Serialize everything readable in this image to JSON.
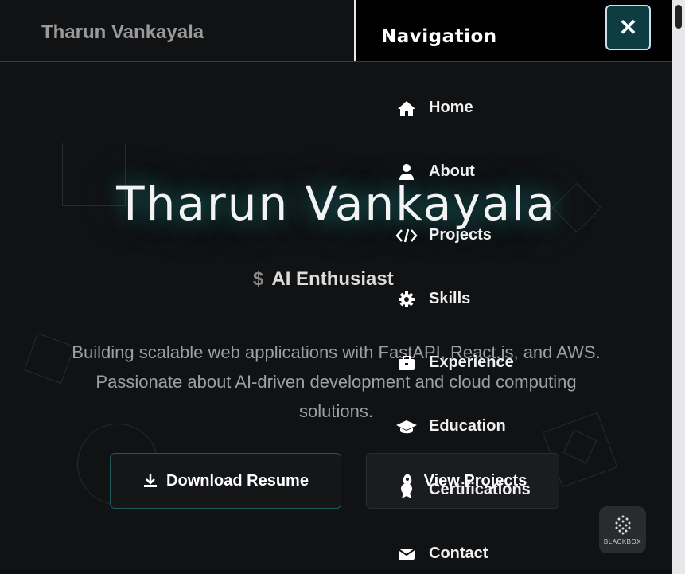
{
  "header": {
    "brand": "Tharun Vankayala"
  },
  "hero": {
    "name": "Tharun Vankayala",
    "role_prefix": "$",
    "role": "AI Enthusiast",
    "description_lines": [
      "Building scalable web applications with FastAPI, React.js, and AWS.",
      "Passionate about AI-driven development and cloud computing",
      "solutions."
    ],
    "buttons": {
      "resume": "Download Resume",
      "projects": "View Projects"
    }
  },
  "nav": {
    "title": "Navigation",
    "close_label": "✕",
    "items": [
      {
        "label": "Home",
        "icon": "home-icon"
      },
      {
        "label": "About",
        "icon": "user-icon"
      },
      {
        "label": "Projects",
        "icon": "code-icon"
      },
      {
        "label": "Skills",
        "icon": "gear-icon"
      },
      {
        "label": "Experience",
        "icon": "briefcase-icon"
      },
      {
        "label": "Education",
        "icon": "graduation-cap-icon"
      },
      {
        "label": "Certifications",
        "icon": "certificate-icon"
      },
      {
        "label": "Contact",
        "icon": "envelope-icon"
      }
    ]
  },
  "widget": {
    "label": "BLACKBOX"
  },
  "colors": {
    "accent": "#1d5a5d",
    "background": "#111214",
    "nav_bg": "#000000"
  }
}
